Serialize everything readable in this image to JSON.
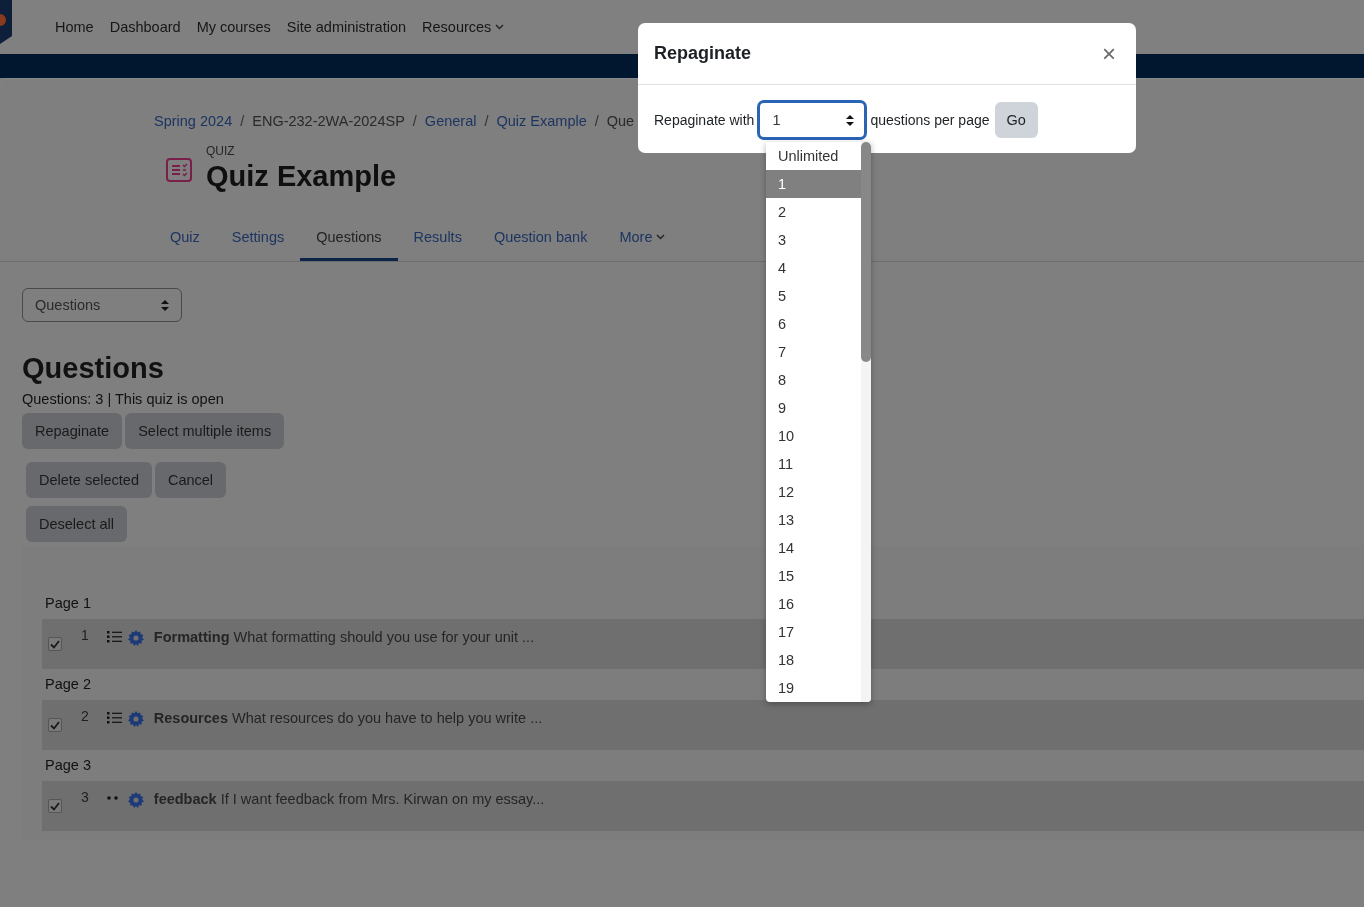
{
  "navbar": {
    "items": [
      {
        "label": "Home",
        "dropdown": false
      },
      {
        "label": "Dashboard",
        "dropdown": false
      },
      {
        "label": "My courses",
        "dropdown": false
      },
      {
        "label": "Site administration",
        "dropdown": false
      },
      {
        "label": "Resources",
        "dropdown": true
      }
    ]
  },
  "breadcrumb": [
    {
      "kind": "item",
      "label": "Spring 2024",
      "link": true
    },
    {
      "kind": "separator",
      "label": "/"
    },
    {
      "kind": "item",
      "label": "ENG-232-2WA-2024SP",
      "link": false
    },
    {
      "kind": "separator",
      "label": "/"
    },
    {
      "kind": "item",
      "label": "General",
      "link": true
    },
    {
      "kind": "separator",
      "label": "/"
    },
    {
      "kind": "item",
      "label": "Quiz Example",
      "link": true
    },
    {
      "kind": "separator",
      "label": "/"
    },
    {
      "kind": "item",
      "label": "Que",
      "link": false
    }
  ],
  "activity": {
    "type_label": "QUIZ",
    "title": "Quiz Example"
  },
  "tabs": [
    {
      "label": "Quiz",
      "selected": false,
      "dropdown": false
    },
    {
      "label": "Settings",
      "selected": false,
      "dropdown": false
    },
    {
      "label": "Questions",
      "selected": true,
      "dropdown": false
    },
    {
      "label": "Results",
      "selected": false,
      "dropdown": false
    },
    {
      "label": "Question bank",
      "selected": false,
      "dropdown": false
    },
    {
      "label": "More",
      "selected": false,
      "dropdown": true
    }
  ],
  "page_select": {
    "value": "Questions"
  },
  "heading": "Questions",
  "summary": "Questions: 3 | This quiz is open",
  "button_rows": [
    [
      "Repaginate",
      "Select multiple items"
    ],
    [
      "Delete selected",
      "Cancel"
    ],
    [
      "Deselect all"
    ]
  ],
  "pages": [
    {
      "label": "Page 1",
      "questions": [
        {
          "number": "1",
          "kind": "multichoice",
          "checked": true,
          "name": "Formatting",
          "text": "What formatting should you use for your unit ..."
        }
      ]
    },
    {
      "label": "Page 2",
      "questions": [
        {
          "number": "2",
          "kind": "multichoice",
          "checked": true,
          "name": "Resources",
          "text": "What resources do you have to help you write ..."
        }
      ]
    },
    {
      "label": "Page 3",
      "questions": [
        {
          "number": "3",
          "kind": "essay",
          "checked": true,
          "name": "feedback",
          "text": "If I want feedback from Mrs. Kirwan on my essay..."
        }
      ]
    }
  ],
  "modal": {
    "title": "Repaginate",
    "close": "×",
    "label_before": "Repaginate with",
    "select_value": "1",
    "label_after": "questions per page",
    "go_button": "Go",
    "options": [
      {
        "label": "Unlimited",
        "selected": false
      },
      {
        "label": "1",
        "selected": true
      },
      {
        "label": "2",
        "selected": false
      },
      {
        "label": "3",
        "selected": false
      },
      {
        "label": "4",
        "selected": false
      },
      {
        "label": "5",
        "selected": false
      },
      {
        "label": "6",
        "selected": false
      },
      {
        "label": "7",
        "selected": false
      },
      {
        "label": "8",
        "selected": false
      },
      {
        "label": "9",
        "selected": false
      },
      {
        "label": "10",
        "selected": false
      },
      {
        "label": "11",
        "selected": false
      },
      {
        "label": "12",
        "selected": false
      },
      {
        "label": "13",
        "selected": false
      },
      {
        "label": "14",
        "selected": false
      },
      {
        "label": "15",
        "selected": false
      },
      {
        "label": "16",
        "selected": false
      },
      {
        "label": "17",
        "selected": false
      },
      {
        "label": "18",
        "selected": false
      },
      {
        "label": "19",
        "selected": false
      }
    ]
  }
}
